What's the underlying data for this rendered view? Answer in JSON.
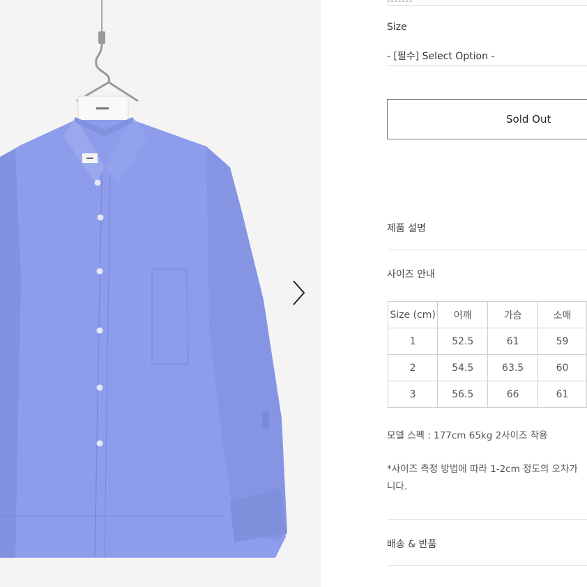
{
  "gallery": {
    "next_arrow": "chevron-right-icon",
    "shirt_color": "#8a9be8"
  },
  "option": {
    "dashes": "-------",
    "size_label": "Size",
    "select_value": "- [필수] Select Option -"
  },
  "buy": {
    "sold_out_label": "Sold Out"
  },
  "sections": {
    "description": "제품 설명",
    "size_guide": "사이즈 안내",
    "shipping": "배송 & 반품"
  },
  "size_table": {
    "headers": [
      "Size (cm)",
      "어깨",
      "가슴",
      "소매"
    ],
    "rows": [
      [
        "1",
        "52.5",
        "61",
        "59"
      ],
      [
        "2",
        "54.5",
        "63.5",
        "60"
      ],
      [
        "3",
        "56.5",
        "66",
        "61"
      ]
    ]
  },
  "notes": {
    "model_spec": "모델 스펙 : 177cm 65kg 2사이즈 착용",
    "measure_line1": "*사이즈 측정 방법에 따라 1-2cm 정도의 오차가",
    "measure_line2": "니다."
  }
}
